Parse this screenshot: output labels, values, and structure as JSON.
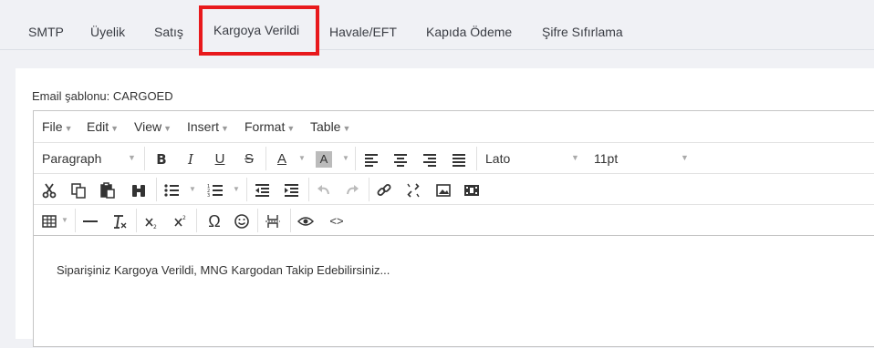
{
  "tabs": [
    {
      "label": "SMTP",
      "active": false
    },
    {
      "label": "Üyelik",
      "active": false
    },
    {
      "label": "Satış",
      "active": false
    },
    {
      "label": "Kargoya Verildi",
      "active": true
    },
    {
      "label": "Havale/EFT",
      "active": false
    },
    {
      "label": "Kapıda Ödeme",
      "active": false
    },
    {
      "label": "Şifre Sıfırlama",
      "active": false
    }
  ],
  "template_label": "Email şablonu: CARGOED",
  "menubar": [
    "File",
    "Edit",
    "View",
    "Insert",
    "Format",
    "Table"
  ],
  "toolbar": {
    "block_format": "Paragraph",
    "font_family": "Lato",
    "font_size": "11pt",
    "bold": "B",
    "italic": "I",
    "underline": "U",
    "strike": "S",
    "text_color": "A",
    "bg_color": "A",
    "omega": "Ω",
    "code": "<>"
  },
  "content_text": "Siparişiniz Kargoya Verildi, MNG Kargodan Takip Edebilirsiniz...",
  "colors": {
    "active_tab_border": "#e8191c",
    "background": "#f0f1f5"
  }
}
